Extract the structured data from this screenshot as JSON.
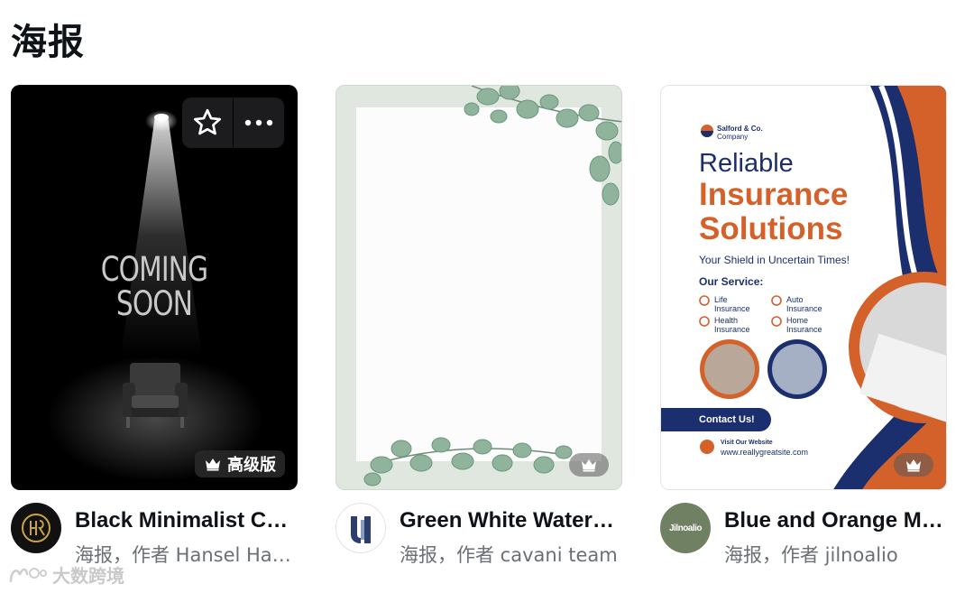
{
  "section": {
    "title": "海报"
  },
  "cards": [
    {
      "thumbnail": {
        "headline": "COMING\nSOON",
        "badge_label": "高级版"
      },
      "actions": {
        "favorite_icon": "star-icon",
        "more_icon": "more-dots-icon"
      },
      "avatar_icon": "hr-logo-icon",
      "title": "Black Minimalist Coming Soon Poster",
      "subtitle": "海报，作者 Hansel Hanifan"
    },
    {
      "thumbnail": {
        "badge_icon": "crown-icon"
      },
      "avatar_icon": "uc-logo-icon",
      "title": "Green White Watercolor Eucalyptus Poster",
      "subtitle": "海报，作者 cavani team"
    },
    {
      "thumbnail": {
        "company": "Salford & Co.",
        "company_sub": "Company",
        "heading_1": "Reliable",
        "heading_2": "Insurance Solutions",
        "tagline": "Your Shield in Uncertain Times!",
        "services_title": "Our Service:",
        "services": [
          "Life\nInsurance",
          "Auto\nInsurance",
          "Health\nInsurance",
          "Home\nInsurance"
        ],
        "cta": "Contact Us!",
        "website_label": "Visit Our Website",
        "website": "www.reallygreatsite.com",
        "badge_icon": "crown-icon"
      },
      "avatar_text": "Jilnoalio",
      "title": "Blue and Orange Modern Insurance Poster",
      "subtitle": "海报，作者 jilnoalio"
    }
  ],
  "watermark": "大数跨境",
  "colors": {
    "navy": "#1b2f6e",
    "orange": "#d4612a",
    "text": "#0e1318",
    "muted": "#6b6f76"
  }
}
